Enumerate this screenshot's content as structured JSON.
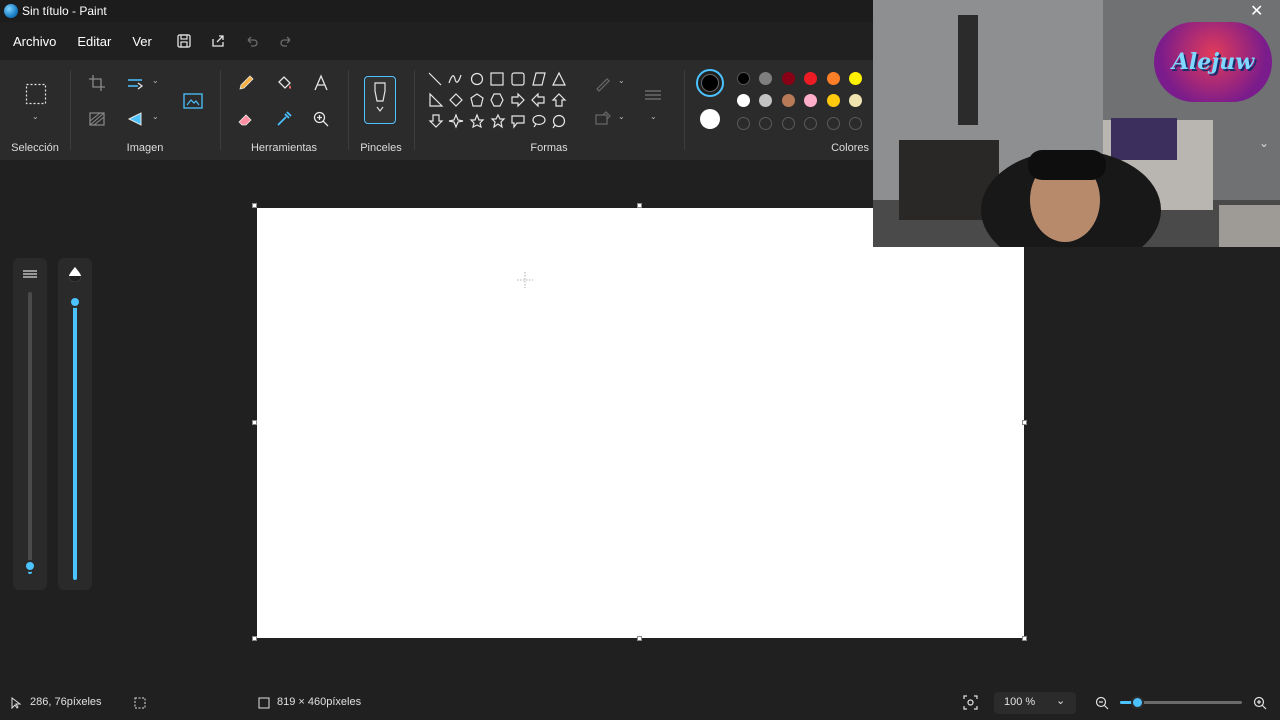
{
  "window": {
    "title": "Sin título - Paint",
    "close_glyph": "✕"
  },
  "menu": {
    "file": "Archivo",
    "edit": "Editar",
    "view": "Ver"
  },
  "ribbon": {
    "selection_label": "Selección",
    "image_label": "Imagen",
    "tools_label": "Herramientas",
    "brushes_label": "Pinceles",
    "shapes_label": "Formas",
    "colors_label": "Colores"
  },
  "colors": {
    "primary": "#000000",
    "secondary": "#ffffff",
    "palette_row1": [
      "#000000",
      "#7f7f7f",
      "#880015",
      "#ed1c24",
      "#ff7f27",
      "#fff200"
    ],
    "palette_row2": [
      "#ffffff",
      "#c3c3c3",
      "#b97a57",
      "#ffaec9",
      "#ffc90e",
      "#efe4b0"
    ],
    "accent": "#4cc2ff"
  },
  "status": {
    "cursor_position": "286, 76píxeles",
    "canvas_size": "819 × 460píxeles",
    "zoom": "100 %"
  },
  "webcam": {
    "logo_text": "Alejuw"
  }
}
